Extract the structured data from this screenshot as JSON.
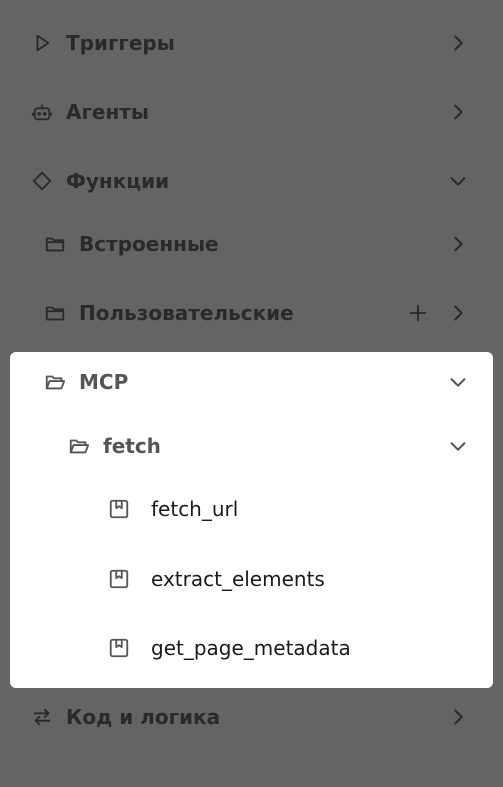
{
  "nav": {
    "triggers": "Триггеры",
    "agents": "Агенты",
    "functions": "Функции",
    "builtin": "Встроенные",
    "custom": "Пользовательские",
    "mcp": "MCP",
    "fetch": "fetch",
    "fetch_items": [
      "fetch_url",
      "extract_elements",
      "get_page_metadata"
    ],
    "code_logic": "Код и логика"
  },
  "icons": {
    "triggers": "play-outline-icon",
    "agents": "robot-icon",
    "functions": "diamond-icon",
    "folder": "folder-icon",
    "folder_open": "folder-open-icon",
    "function_item": "bookmark-box-icon",
    "code_logic": "swap-arrows-icon",
    "expand": "chevron-right-icon",
    "collapse": "chevron-down-icon",
    "add": "plus-icon"
  },
  "colors": {
    "overlay_background": "#646464",
    "panel_background": "#ffffff"
  }
}
